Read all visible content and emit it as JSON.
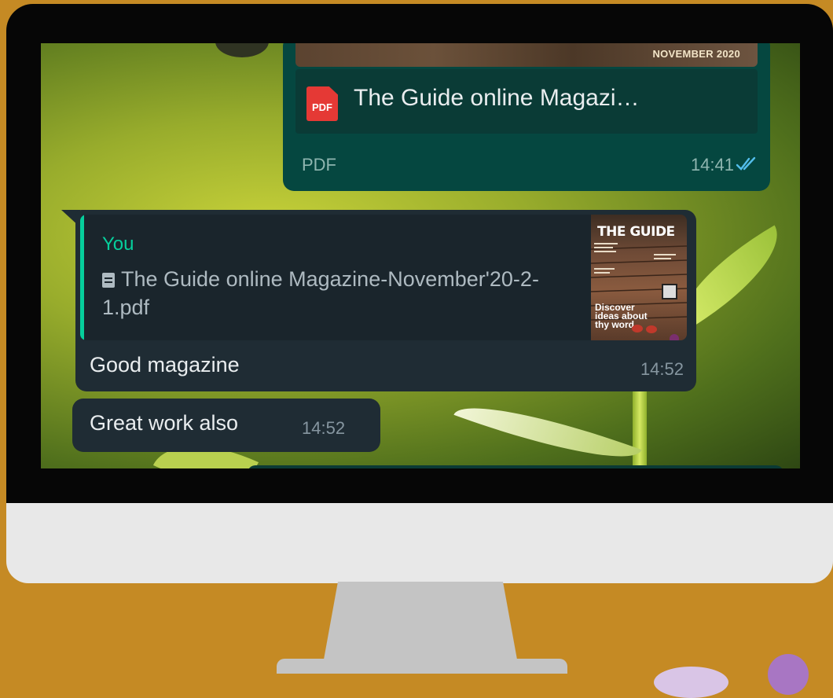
{
  "colors": {
    "background": "#c58a24",
    "outgoing_bubble": "#054740",
    "incoming_bubble": "#1f2c34",
    "accent_green": "#06cf9c",
    "read_ticks": "#53bdeb",
    "pdf_red": "#e53935"
  },
  "chat": {
    "outgoing_pdf": {
      "preview_caption": "NOVEMBER 2020",
      "icon": "pdf-icon",
      "icon_label": "PDF",
      "filename": "The Guide online Magazi…",
      "file_type": "PDF",
      "time": "14:41",
      "status_icon": "double-check-read-icon"
    },
    "reply_message": {
      "quoted_sender": "You",
      "quoted_icon": "document-icon",
      "quoted_file": "The Guide online Magazine-November'20-2-1.pdf",
      "thumbnail_title": "THE GUIDE",
      "thumbnail_tagline": "Discover ideas about thy word.",
      "text": "Good magazine",
      "time": "14:52"
    },
    "followup_message": {
      "text": "Great work also",
      "time": "14:52"
    }
  }
}
